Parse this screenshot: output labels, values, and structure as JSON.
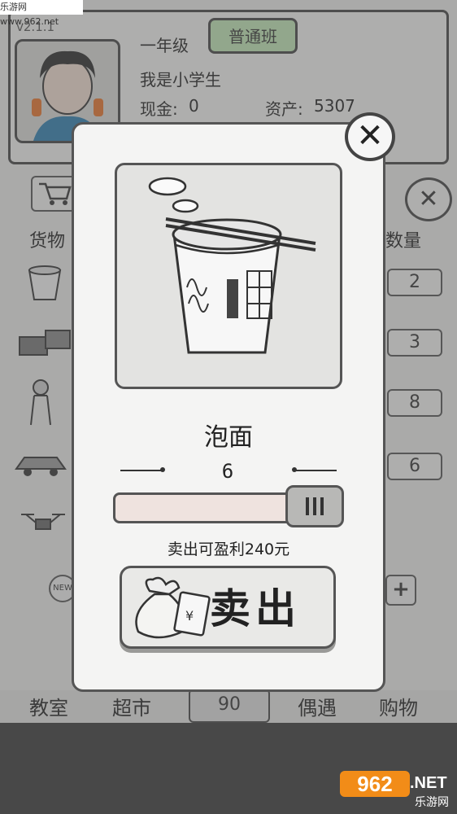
{
  "watermark": {
    "top_text": "乐游网 www.962.net",
    "logo_text": "962",
    "logo_suffix": ".NET",
    "logo_sub": "乐游网"
  },
  "header": {
    "version": "v2.1.1",
    "grade": "一年级",
    "class_tag": "普通班",
    "title": "我是小学生",
    "cash_label": "现金:",
    "cash_value": "0",
    "assets_label": "资产:",
    "assets_value": "5307"
  },
  "list": {
    "left_header": "货物",
    "right_header": "数量",
    "quantities": [
      "2",
      "3",
      "8",
      "6"
    ]
  },
  "bottom_tabs": [
    "教室",
    "超市",
    "偶遇",
    "购物"
  ],
  "bottom_center_value": "90",
  "modal": {
    "item_name": "泡面",
    "quantity": "6",
    "slider_fraction": 1.0,
    "profit_text": "卖出可盈利240元",
    "sell_label": "卖出",
    "close_symbol": "✕"
  },
  "colors": {
    "class_tag_bg": "#bfe6b4",
    "slider_track": "#efe3df",
    "overlay": "rgba(90,90,90,0.45)"
  }
}
